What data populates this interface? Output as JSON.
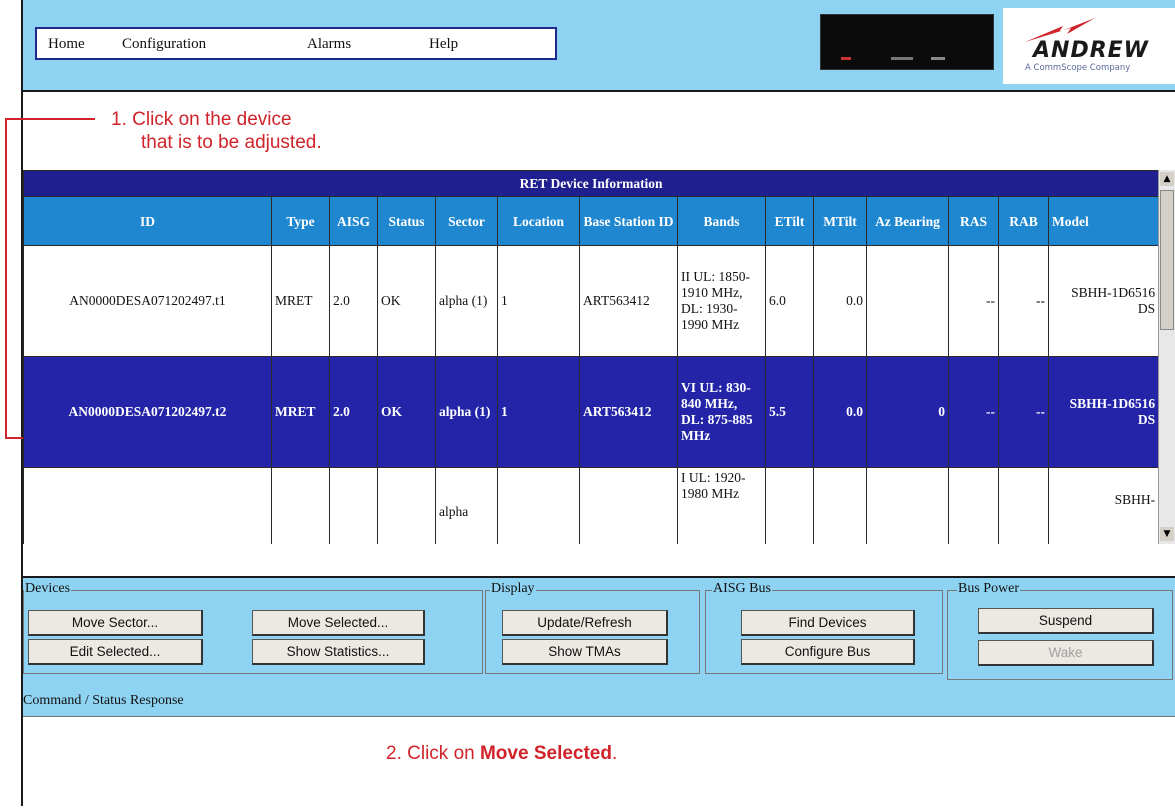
{
  "menu": {
    "items": [
      "Home",
      "Configuration",
      "Alarms",
      "Help"
    ]
  },
  "logo": {
    "brand": "ANDREW",
    "tagline": "A CommScope Company"
  },
  "annotations": {
    "step1_line1": "1. Click on the device",
    "step1_line2": "that is to be adjusted.",
    "step2_prefix": "2.  Click on ",
    "step2_bold": "Move Selected",
    "step2_suffix": "."
  },
  "table": {
    "caption": "RET Device Information",
    "headers": [
      "ID",
      "Type",
      "AISG",
      "Status",
      "Sector",
      "Location",
      "Base Station ID",
      "Bands",
      "ETilt",
      "MTilt",
      "Az Bearing",
      "RAS",
      "RAB",
      "Model"
    ],
    "rows": [
      {
        "id": "AN0000DESA071202497.t1",
        "type": "MRET",
        "aisg": "2.0",
        "status": "OK",
        "sector": "alpha (1)",
        "location": "1",
        "base_station": "ART563412",
        "bands": "II UL: 1850-1910 MHz, DL: 1930-1990 MHz",
        "etilt": "6.0",
        "mtilt": "0.0",
        "az": "",
        "ras": "--",
        "rab": "--",
        "model": "SBHH-1D6516 DS"
      },
      {
        "id": "AN0000DESA071202497.t2",
        "type": "MRET",
        "aisg": "2.0",
        "status": "OK",
        "sector": "alpha (1)",
        "location": "1",
        "base_station": "ART563412",
        "bands": "VI UL: 830-840 MHz, DL: 875-885 MHz",
        "etilt": "5.5",
        "mtilt": "0.0",
        "az": "0",
        "ras": "--",
        "rab": "--",
        "model": "SBHH-1D6516 DS"
      },
      {
        "id": "",
        "type": "",
        "aisg": "",
        "status": "",
        "sector": "alpha",
        "location": "",
        "base_station": "",
        "bands": "I UL: 1920-1980 MHz",
        "etilt": "",
        "mtilt": "",
        "az": "",
        "ras": "",
        "rab": "",
        "model": "SBHH-"
      }
    ]
  },
  "groups": {
    "devices": "Devices",
    "display": "Display",
    "aisg_bus": "AISG Bus",
    "bus_power": "Bus Power"
  },
  "buttons": {
    "move_sector": "Move Sector...",
    "move_selected": "Move Selected...",
    "edit_selected": "Edit Selected...",
    "show_statistics": "Show Statistics...",
    "update_refresh": "Update/Refresh",
    "show_tmas": "Show TMAs",
    "find_devices": "Find Devices",
    "configure_bus": "Configure Bus",
    "suspend": "Suspend",
    "wake": "Wake"
  },
  "command_status_label": "Command / Status Response",
  "colors": {
    "accent_red": "#d0232a",
    "header_blue": "#1f87d0",
    "selected_row": "#2424a8",
    "panel_bg": "#8fd3f2"
  }
}
